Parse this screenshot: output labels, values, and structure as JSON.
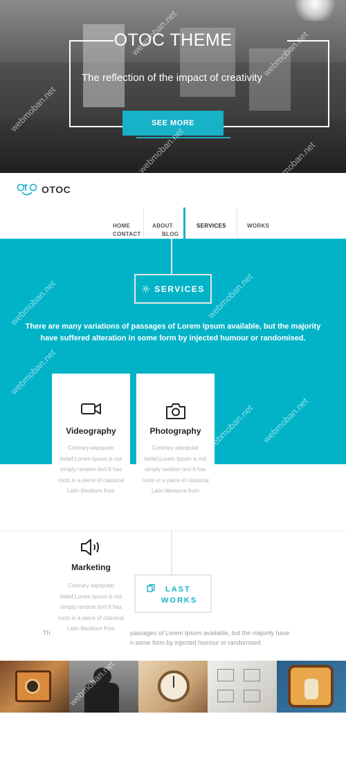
{
  "hero": {
    "title": "OTOC THEME",
    "tagline": "The reflection of the impact of creativity",
    "cta_label": "SEE MORE"
  },
  "brand": {
    "logo_text": "OTOC",
    "accent_color": "#17b1c8"
  },
  "nav": {
    "items": [
      {
        "label": "HOME"
      },
      {
        "label": "ABOUT"
      },
      {
        "label": "SERVICES",
        "active": true
      },
      {
        "label": "WORKS"
      },
      {
        "label": "CONTACT"
      },
      {
        "label": "BLOG"
      }
    ]
  },
  "services": {
    "heading": "SERVICES",
    "icon": "gear-icon",
    "description": "There are many variations of passages of Lorem Ipsum available, but the majority have suffered alteration in some form by injected humour or randomised.",
    "cards": [
      {
        "title": "Videography",
        "icon": "video-camera-icon",
        "text": "Contrary wipopular belief,Lorem Ipsum is not simply random text It has roots in a piece of classical Latin literature from"
      },
      {
        "title": "Photography",
        "icon": "camera-icon",
        "text": "Contrary wipopular belief,Lorem Ipsum is not simply random text It has roots in a piece of classical Latin literature from"
      },
      {
        "title": "Marketing",
        "icon": "megaphone-icon",
        "text": "Contrary wipopular belief,Lorem Ipsum is not simply random text It has roots in a piece of classical Latin literature from"
      }
    ]
  },
  "works": {
    "heading_line1": "LAST",
    "heading_line2": "WORKS",
    "icon": "copy-icon",
    "text_left_1": "Th",
    "text_right_1": "passages of Lorem Ipsum available, but the majority have",
    "text_right_2": "n some form by injected humour or randomised."
  },
  "watermark": "webmoban.net"
}
